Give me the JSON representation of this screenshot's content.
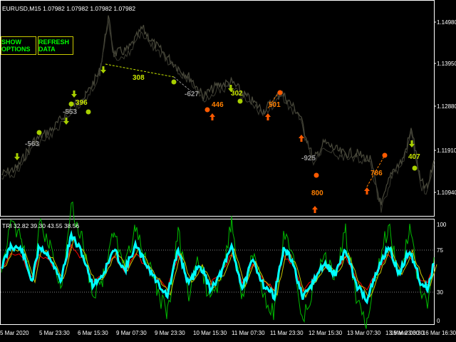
{
  "window": {
    "header": "EURUSD,M15  1.07982 1.07982 1.07982 1.07982",
    "indicator_header": "TRI 32.82 39.30 43.55 38.56"
  },
  "buttons": {
    "show_options": "SHOW OPTIONS",
    "refresh_data": "REFRESH DATA"
  },
  "colors": {
    "background": "#000000",
    "price_line": "#4a4a3c",
    "trendline": "#c8e600",
    "buy_label": "#c8e600",
    "sell_label": "#ff7f00",
    "loss_label": "#999999",
    "sell_arrow": "#ff5a00",
    "buy_arrow": "#a8d000",
    "osc_main": "#00ffff",
    "osc_fast": "#00bb00",
    "osc_red": "#ff0000",
    "osc_yellow": "#c8c800",
    "level": "#aaaaaa",
    "scale_text": "#ffffff",
    "frame": "#ffffff"
  },
  "price_scale": [
    "1.14980",
    "1.13950",
    "1.12880",
    "1.11910",
    "1.10940"
  ],
  "osc_scale": [
    "100",
    "75",
    "30",
    "0"
  ],
  "time_axis": [
    "5 Mar 2020",
    "5 Mar 23:30",
    "6 Mar 15:30",
    "9 Mar 07:30",
    "9 Mar 23:30",
    "10 Mar 15:30",
    "11 Mar 07:30",
    "11 Mar 23:30",
    "12 Mar 15:30",
    "13 Mar 07:30",
    "13 Mar 23:30",
    "16 Mar 00:30",
    "16 Mar 16:30"
  ],
  "signals": [
    {
      "text": "-563",
      "kind": "loss"
    },
    {
      "text": "-553",
      "kind": "loss"
    },
    {
      "text": "396",
      "kind": "buy"
    },
    {
      "text": "308",
      "kind": "buy"
    },
    {
      "text": "-627",
      "kind": "loss"
    },
    {
      "text": "446",
      "kind": "sell"
    },
    {
      "text": "302",
      "kind": "buy"
    },
    {
      "text": "501",
      "kind": "sell"
    },
    {
      "text": "-925",
      "kind": "loss"
    },
    {
      "text": "800",
      "kind": "sell"
    },
    {
      "text": "786",
      "kind": "sell"
    },
    {
      "text": "407",
      "kind": "buy"
    }
  ]
}
